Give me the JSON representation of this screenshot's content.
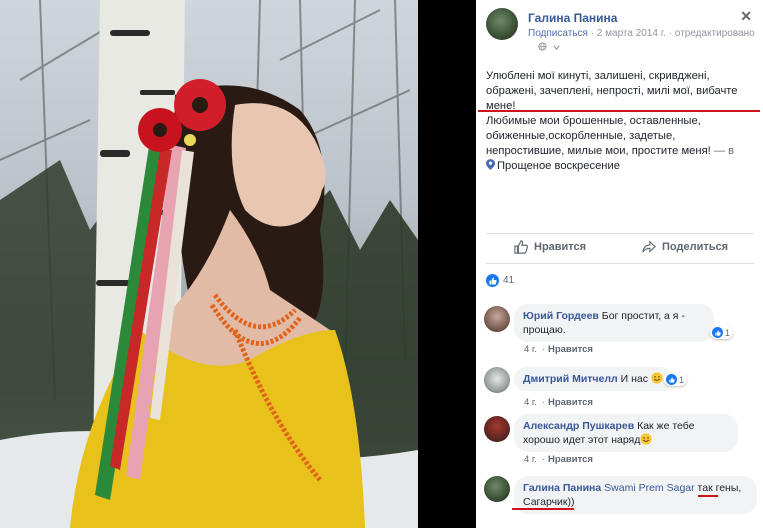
{
  "post": {
    "author": "Галина Панина",
    "subscribe": "Подписаться",
    "date": "· 2 марта 2014 г. · отредактировано",
    "text_ua": "Улюблені мої кинуті, залишені, скривджені, ображені, зачеплені, непрості, милі мої, вибачте мене!",
    "text_ru": "Любимые мои брошенные, оставленные, обиженные,оскорбленные, задетые, непростившие, милые мои, простите меня!",
    "in_label": "— в",
    "location": "Прощеное воскресение",
    "like_button": "Нравится",
    "share_button": "Поделиться",
    "likes_count": "41"
  },
  "comments": [
    {
      "name": "Юрий Гордеев",
      "text": "Бог простит, а я - прощаю.",
      "time": "4 г.",
      "like": "Нравится",
      "reactions": "1"
    },
    {
      "name": "Дмитрий Митчелл",
      "text": "И нас",
      "time": "4 г.",
      "like": "Нравится",
      "reactions": "1"
    },
    {
      "name": "Александр Пушкарев",
      "text": "Как же тебе хорошо идет этот наряд",
      "time": "4 г.",
      "like": "Нравится"
    },
    {
      "name": "Галина Панина",
      "tag": "Swami Prem Sagar",
      "text": "так гены, Сагарчик))",
      "text_a": "так",
      "text_b": "гены, Сагарчик))"
    }
  ],
  "colors": {
    "link": "#385898",
    "like_blue": "#1877f2",
    "underline_red": "#d0131a",
    "bubble_bg": "#f2f3f5"
  },
  "icons": [
    "globe-icon",
    "close-icon",
    "pin-icon",
    "thumbs-up-icon",
    "share-icon",
    "like-icon",
    "smile-emoji-icon"
  ]
}
